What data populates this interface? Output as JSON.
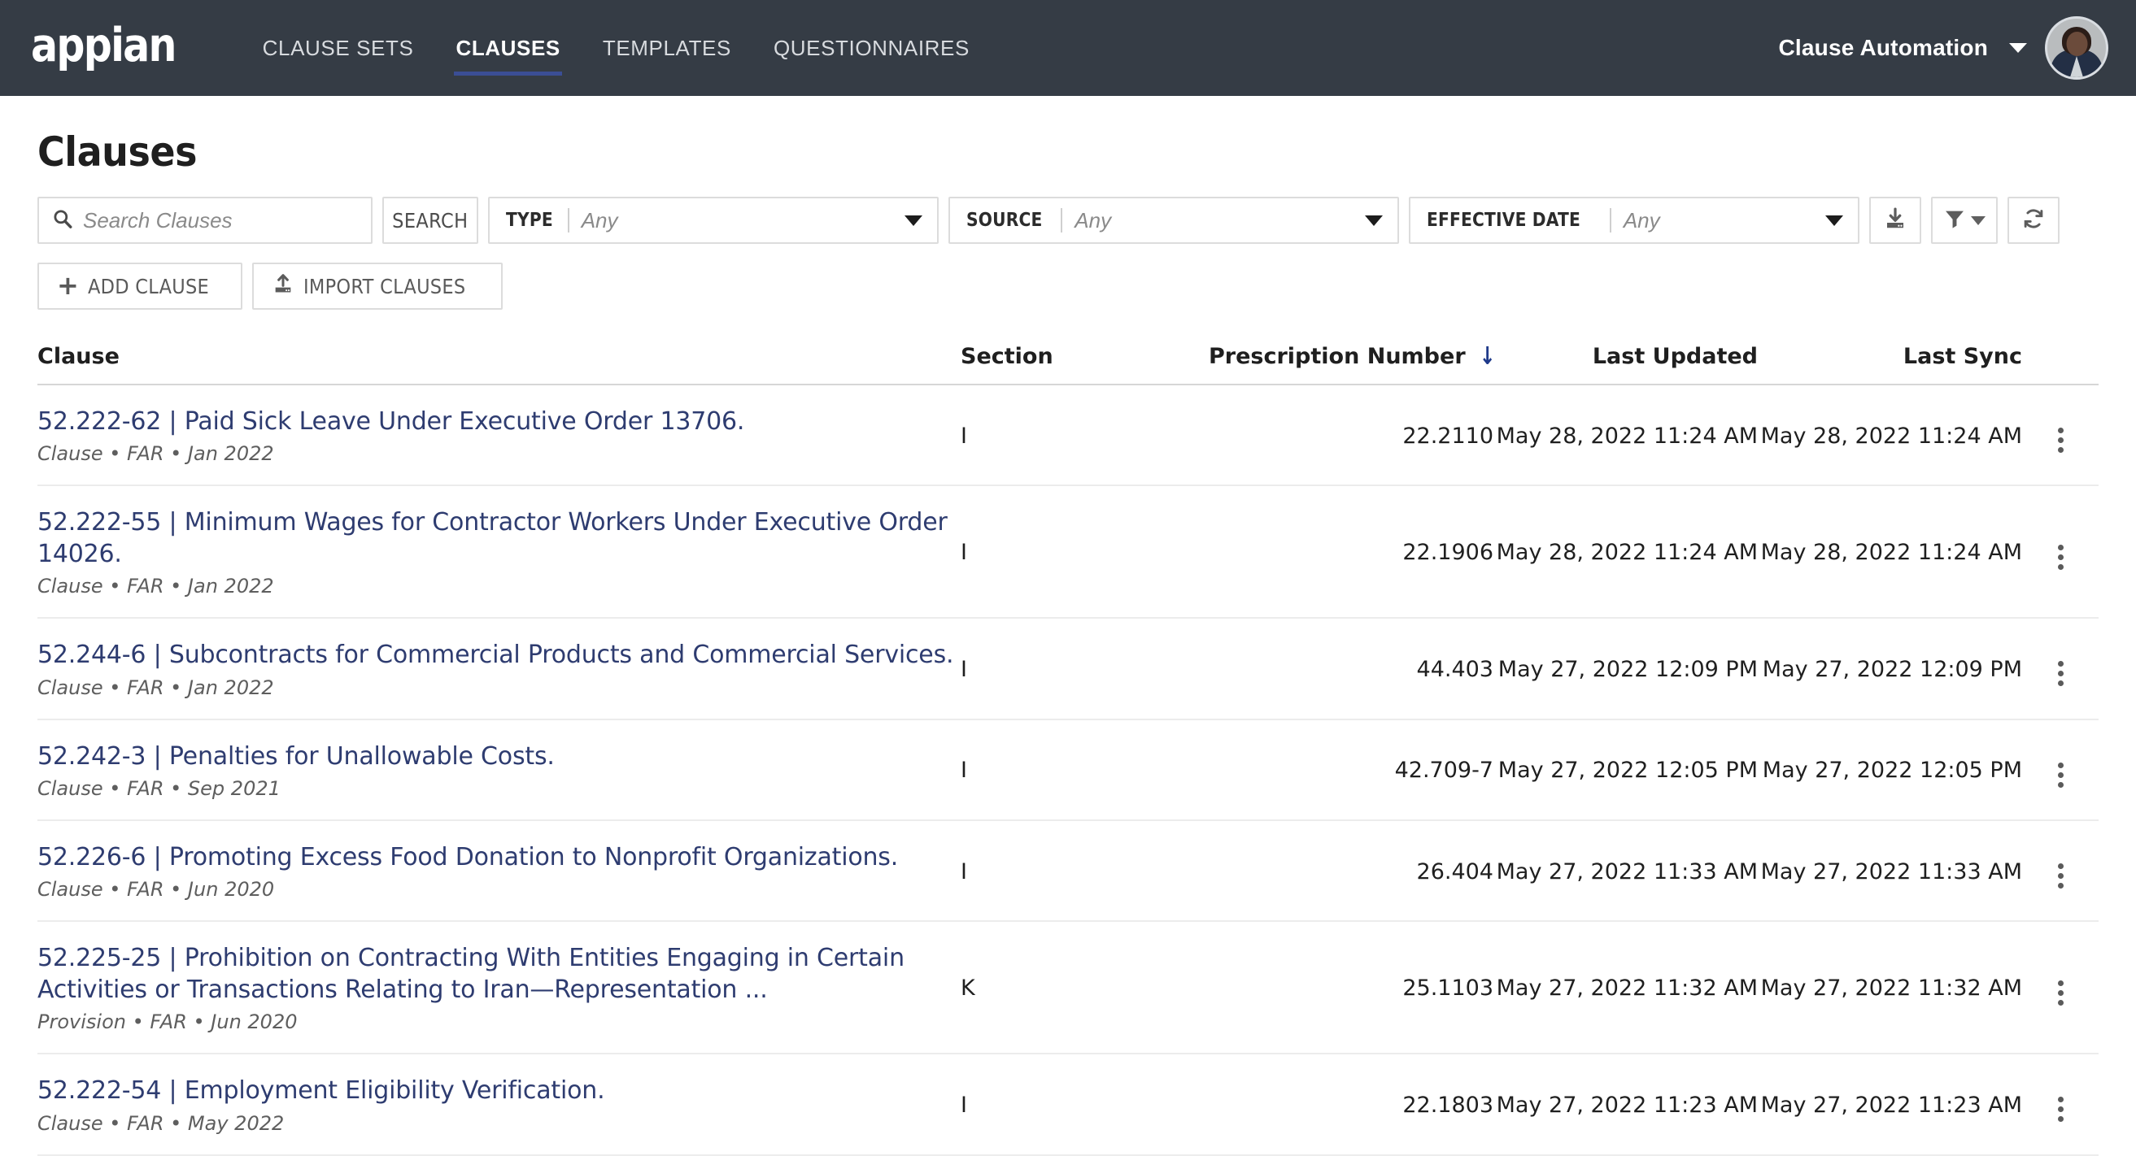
{
  "nav": {
    "brand": "appian",
    "items": [
      {
        "label": "CLAUSE SETS",
        "active": false
      },
      {
        "label": "CLAUSES",
        "active": true
      },
      {
        "label": "TEMPLATES",
        "active": false
      },
      {
        "label": "QUESTIONNAIRES",
        "active": false
      }
    ],
    "account": "Clause Automation",
    "accent_color": "#3b4e95",
    "bar_color": "#353c45"
  },
  "page": {
    "title": "Clauses"
  },
  "toolbar": {
    "search_placeholder": "Search Clauses",
    "search_value": "",
    "search_button": "SEARCH",
    "filters": [
      {
        "label": "TYPE",
        "value": "Any"
      },
      {
        "label": "SOURCE",
        "value": "Any"
      },
      {
        "label": "EFFECTIVE DATE",
        "value": "Any"
      }
    ],
    "icon_buttons": [
      {
        "name": "download-icon",
        "title": "Export"
      },
      {
        "name": "filter-icon",
        "title": "Filter"
      },
      {
        "name": "refresh-icon",
        "title": "Refresh"
      }
    ]
  },
  "actions": [
    {
      "label": "ADD CLAUSE",
      "icon": "plus-icon"
    },
    {
      "label": "IMPORT CLAUSES",
      "icon": "upload-icon"
    }
  ],
  "table": {
    "columns": [
      {
        "key": "clause",
        "label": "Clause",
        "sorted": false
      },
      {
        "key": "section",
        "label": "Section",
        "sorted": false
      },
      {
        "key": "prescription_number",
        "label": "Prescription Number",
        "sorted": true,
        "sort_dir": "desc",
        "sort_glyph": "↓"
      },
      {
        "key": "last_updated",
        "label": "Last Updated",
        "sorted": false
      },
      {
        "key": "last_sync",
        "label": "Last Sync",
        "sorted": false
      }
    ],
    "rows": [
      {
        "title": "52.222-62 | Paid Sick Leave Under Executive Order 13706.",
        "meta": "Clause • FAR • Jan 2022",
        "section": "I",
        "prescription_number": "22.2110",
        "last_updated": "May 28, 2022 11:24 AM",
        "last_sync": "May 28, 2022 11:24 AM"
      },
      {
        "title": "52.222-55 | Minimum Wages for Contractor Workers Under Executive Order 14026.",
        "meta": "Clause • FAR • Jan 2022",
        "section": "I",
        "prescription_number": "22.1906",
        "last_updated": "May 28, 2022 11:24 AM",
        "last_sync": "May 28, 2022 11:24 AM"
      },
      {
        "title": "52.244-6 | Subcontracts for Commercial Products and Commercial Services.",
        "meta": "Clause • FAR • Jan 2022",
        "section": "I",
        "prescription_number": "44.403",
        "last_updated": "May 27, 2022 12:09 PM",
        "last_sync": "May 27, 2022 12:09 PM"
      },
      {
        "title": "52.242-3 | Penalties for Unallowable Costs.",
        "meta": "Clause • FAR • Sep 2021",
        "section": "I",
        "prescription_number": "42.709-7",
        "last_updated": "May 27, 2022 12:05 PM",
        "last_sync": "May 27, 2022 12:05 PM"
      },
      {
        "title": "52.226-6 | Promoting Excess Food Donation to Nonprofit Organizations.",
        "meta": "Clause • FAR • Jun 2020",
        "section": "I",
        "prescription_number": "26.404",
        "last_updated": "May 27, 2022 11:33 AM",
        "last_sync": "May 27, 2022 11:33 AM"
      },
      {
        "title": "52.225-25 | Prohibition on Contracting With Entities Engaging in Certain Activities or Transactions Relating to Iran—Representation ...",
        "meta": "Provision • FAR • Jun 2020",
        "section": "K",
        "prescription_number": "25.1103",
        "last_updated": "May 27, 2022 11:32 AM",
        "last_sync": "May 27, 2022 11:32 AM"
      },
      {
        "title": "52.222-54 | Employment Eligibility Verification.",
        "meta": "Clause • FAR • May 2022",
        "section": "I",
        "prescription_number": "22.1803",
        "last_updated": "May 27, 2022 11:23 AM",
        "last_sync": "May 27, 2022 11:23 AM"
      }
    ]
  },
  "colors": {
    "link": "#2e3c70",
    "nav_bg": "#353c45",
    "sort_arrow": "#1f3a8a"
  }
}
